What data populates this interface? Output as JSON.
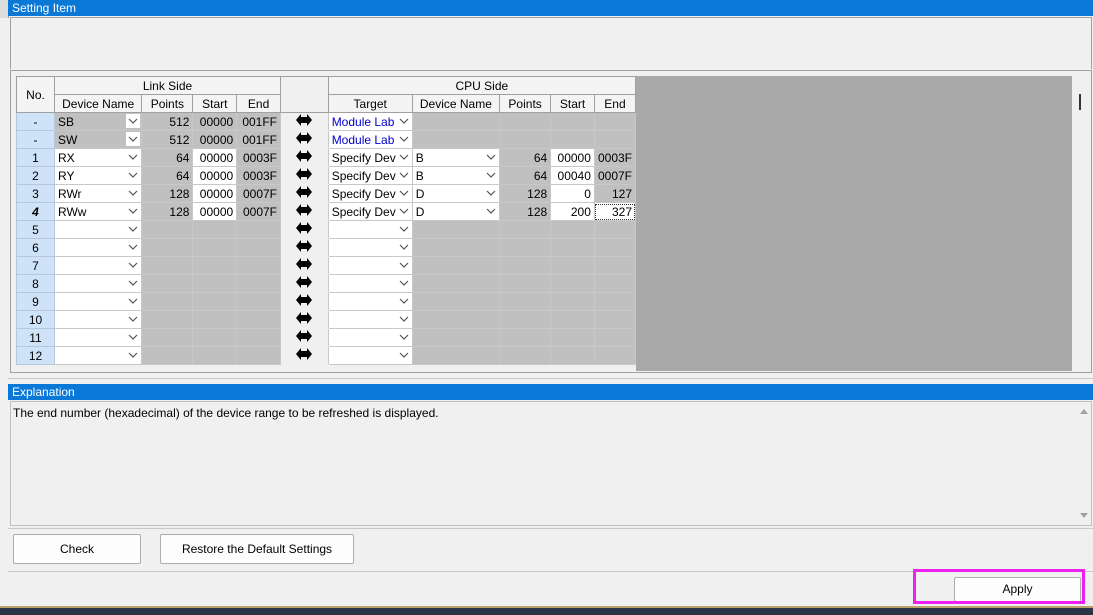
{
  "setting_item": {
    "title": "Setting Item"
  },
  "grid": {
    "header": {
      "no": "No.",
      "link_side": "Link Side",
      "cpu_side": "CPU Side",
      "device_name": "Device Name",
      "points": "Points",
      "start": "Start",
      "end": "End",
      "target": "Target",
      "cpu_device_name": "Device Name",
      "cpu_points": "Points",
      "cpu_start": "Start",
      "cpu_end": "End"
    },
    "rows": [
      {
        "no": "-",
        "device": "SB",
        "points": "512",
        "start": "00000",
        "end": "001FF",
        "target": "Module Lab",
        "cpu_device": "",
        "cpu_points": "",
        "cpu_start": "",
        "cpu_end": ""
      },
      {
        "no": "-",
        "device": "SW",
        "points": "512",
        "start": "00000",
        "end": "001FF",
        "target": "Module Lab",
        "cpu_device": "",
        "cpu_points": "",
        "cpu_start": "",
        "cpu_end": ""
      },
      {
        "no": "1",
        "device": "RX",
        "points": "64",
        "start": "00000",
        "end": "0003F",
        "target": "Specify Dev",
        "cpu_device": "B",
        "cpu_points": "64",
        "cpu_start": "00000",
        "cpu_end": "0003F"
      },
      {
        "no": "2",
        "device": "RY",
        "points": "64",
        "start": "00000",
        "end": "0003F",
        "target": "Specify Dev",
        "cpu_device": "B",
        "cpu_points": "64",
        "cpu_start": "00040",
        "cpu_end": "0007F"
      },
      {
        "no": "3",
        "device": "RWr",
        "points": "128",
        "start": "00000",
        "end": "0007F",
        "target": "Specify Dev",
        "cpu_device": "D",
        "cpu_points": "128",
        "cpu_start": "0",
        "cpu_end": "127"
      },
      {
        "no": "4",
        "device": "RWw",
        "points": "128",
        "start": "00000",
        "end": "0007F",
        "target": "Specify Dev",
        "cpu_device": "D",
        "cpu_points": "128",
        "cpu_start": "200",
        "cpu_end": "327"
      },
      {
        "no": "5"
      },
      {
        "no": "6"
      },
      {
        "no": "7"
      },
      {
        "no": "8"
      },
      {
        "no": "9"
      },
      {
        "no": "10"
      },
      {
        "no": "11"
      },
      {
        "no": "12"
      }
    ]
  },
  "explanation": {
    "title": "Explanation",
    "text": "The end number (hexadecimal) of the device range to be refreshed is displayed."
  },
  "buttons": {
    "check": "Check",
    "restore": "Restore the Default Settings",
    "apply": "Apply"
  },
  "colors": {
    "title_bar": "#0a78d7",
    "highlight": "#ee20ee",
    "row_header": "#cfe3f8"
  }
}
